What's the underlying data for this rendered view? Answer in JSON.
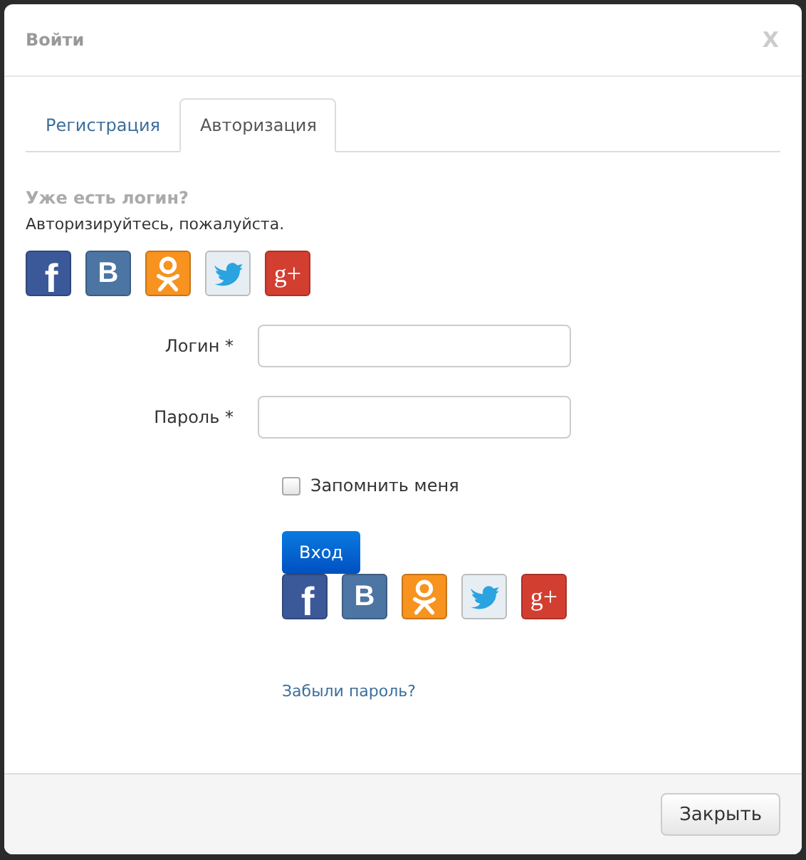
{
  "dialog": {
    "title": "Войти",
    "close": "X"
  },
  "tabs": [
    {
      "label": "Регистрация",
      "selected": false
    },
    {
      "label": "Авторизация",
      "selected": true
    }
  ],
  "intro": {
    "heading": "Уже есть логин?",
    "text": "Авторизируйтесь, пожалуйста."
  },
  "social_top": [
    {
      "kind": "facebook",
      "glyph": "f"
    },
    {
      "kind": "vk",
      "glyph": "B"
    },
    {
      "kind": "ok"
    },
    {
      "kind": "twitter"
    },
    {
      "kind": "google",
      "glyph": "g+"
    }
  ],
  "fields": [
    {
      "label": "Логин *"
    },
    {
      "label": "Пароль *"
    }
  ],
  "remember": {
    "label": "Запомнить меня",
    "checked": false
  },
  "login_button": "Вход",
  "social_bottom": [
    {
      "kind": "facebook",
      "glyph": "f"
    },
    {
      "kind": "vk",
      "glyph": "B"
    },
    {
      "kind": "ok"
    },
    {
      "kind": "twitter"
    },
    {
      "kind": "google",
      "glyph": "g+"
    }
  ],
  "forgot_link": "Забыли пароль?",
  "footer_button": "Закрыть"
}
